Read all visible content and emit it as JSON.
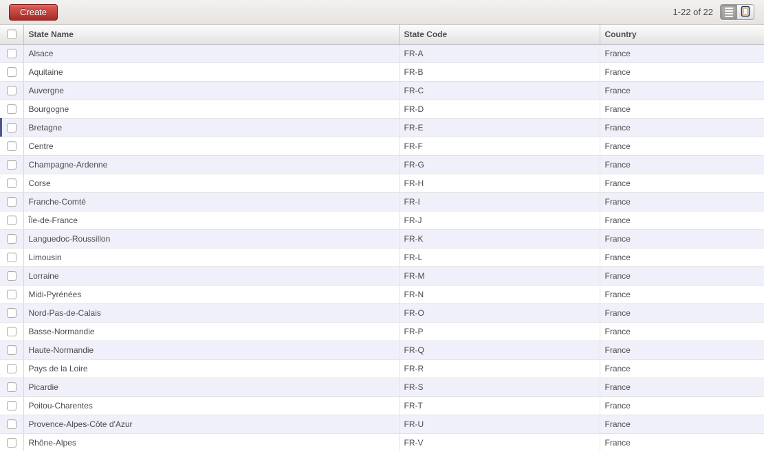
{
  "toolbar": {
    "create_label": "Create",
    "pager_text": "1-22 of 22",
    "view_switcher": {
      "list_icon": "list-view-icon",
      "form_icon": "form-view-icon",
      "active_view": "list"
    }
  },
  "table": {
    "columns": [
      {
        "label": "State Name"
      },
      {
        "label": "State Code"
      },
      {
        "label": "Country"
      }
    ],
    "active_row_index": 4,
    "rows": [
      {
        "name": "Alsace",
        "code": "FR-A",
        "country": "France"
      },
      {
        "name": "Aquitaine",
        "code": "FR-B",
        "country": "France"
      },
      {
        "name": "Auvergne",
        "code": "FR-C",
        "country": "France"
      },
      {
        "name": "Bourgogne",
        "code": "FR-D",
        "country": "France"
      },
      {
        "name": "Bretagne",
        "code": "FR-E",
        "country": "France"
      },
      {
        "name": "Centre",
        "code": "FR-F",
        "country": "France"
      },
      {
        "name": "Champagne-Ardenne",
        "code": "FR-G",
        "country": "France"
      },
      {
        "name": "Corse",
        "code": "FR-H",
        "country": "France"
      },
      {
        "name": "Franche-Comté",
        "code": "FR-I",
        "country": "France"
      },
      {
        "name": "Île-de-France",
        "code": "FR-J",
        "country": "France"
      },
      {
        "name": "Languedoc-Roussillon",
        "code": "FR-K",
        "country": "France"
      },
      {
        "name": "Limousin",
        "code": "FR-L",
        "country": "France"
      },
      {
        "name": "Lorraine",
        "code": "FR-M",
        "country": "France"
      },
      {
        "name": "Midi-Pyrénées",
        "code": "FR-N",
        "country": "France"
      },
      {
        "name": "Nord-Pas-de-Calais",
        "code": "FR-O",
        "country": "France"
      },
      {
        "name": "Basse-Normandie",
        "code": "FR-P",
        "country": "France"
      },
      {
        "name": "Haute-Normandie",
        "code": "FR-Q",
        "country": "France"
      },
      {
        "name": "Pays de la Loire",
        "code": "FR-R",
        "country": "France"
      },
      {
        "name": "Picardie",
        "code": "FR-S",
        "country": "France"
      },
      {
        "name": "Poitou-Charentes",
        "code": "FR-T",
        "country": "France"
      },
      {
        "name": "Provence-Alpes-Côte d'Azur",
        "code": "FR-U",
        "country": "France"
      },
      {
        "name": "Rhône-Alpes",
        "code": "FR-V",
        "country": "France"
      }
    ]
  },
  "colors": {
    "accent_red": "#b33630",
    "row_stripe": "#f0f0fa",
    "active_marker": "#4d568c",
    "text": "#4c4c4c"
  }
}
